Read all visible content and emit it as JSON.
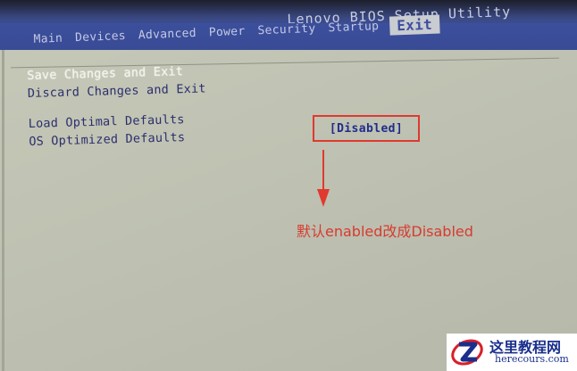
{
  "header": {
    "title": "Lenovo BIOS Setup Utility"
  },
  "tabs": [
    {
      "label": "Main"
    },
    {
      "label": "Devices"
    },
    {
      "label": "Advanced"
    },
    {
      "label": "Power"
    },
    {
      "label": "Security"
    },
    {
      "label": "Startup"
    },
    {
      "label": "Exit",
      "active": true
    }
  ],
  "menu": {
    "items": [
      {
        "label": "Save Changes and Exit",
        "selected": true
      },
      {
        "label": "Discard Changes and Exit"
      },
      {
        "label": "Load Optimal Defaults"
      },
      {
        "label": "OS Optimized Defaults"
      }
    ],
    "os_optimized_value": "[Disabled]"
  },
  "annotation": {
    "note": "默认enabled改成Disabled",
    "color": "#d83a2f"
  },
  "watermark": {
    "title": "这里教程网",
    "url": "herecours.com"
  },
  "colors": {
    "menubar": "#3b4f9d",
    "panel": "#c3c5b5",
    "text": "#2b2f6d",
    "value": "#1f2d8c"
  }
}
